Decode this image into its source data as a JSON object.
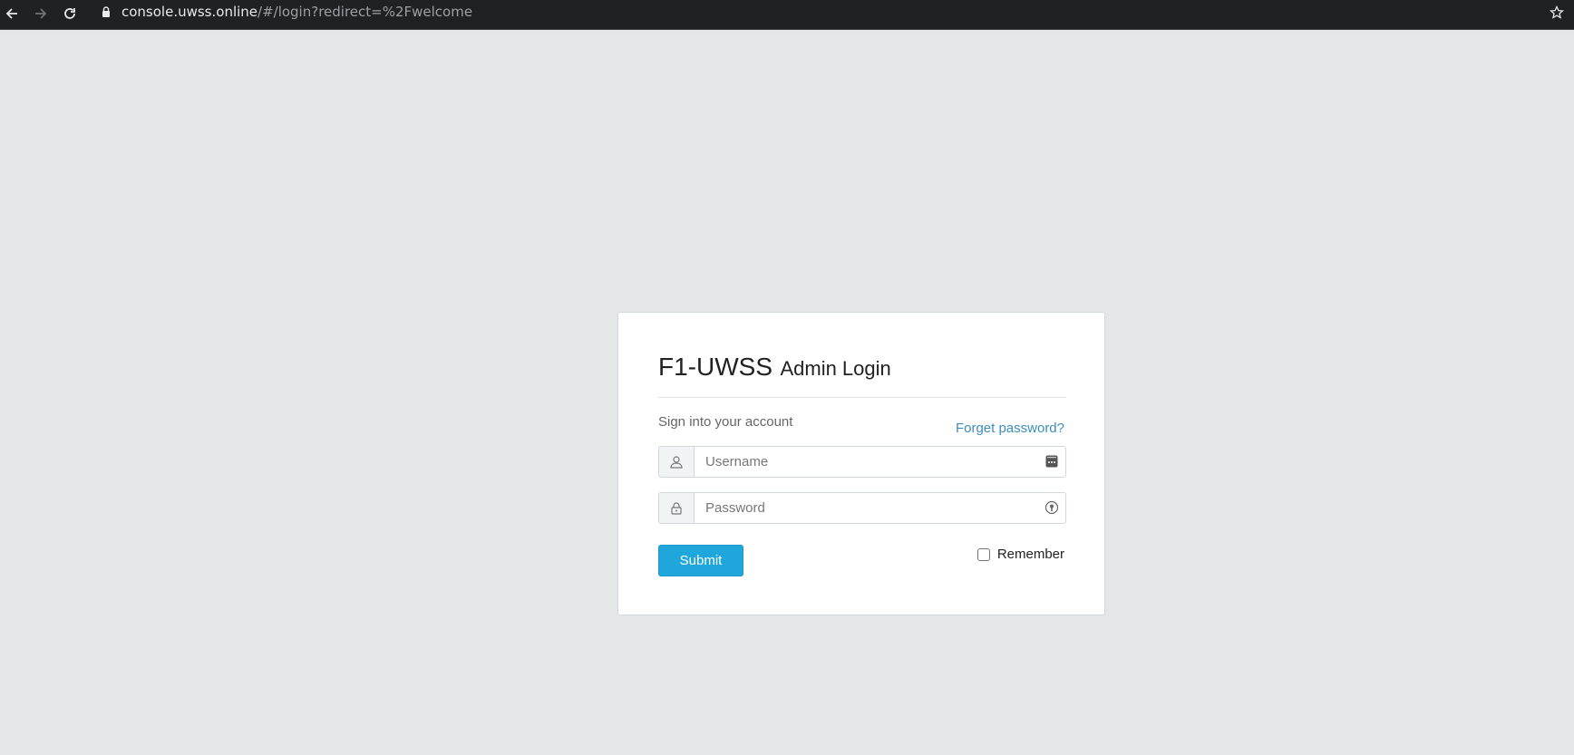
{
  "browser": {
    "url_host": "console.uwss.online",
    "url_path": "/#/login?redirect=%2Fwelcome",
    "icons": [
      "back-arrow-icon",
      "forward-arrow-icon",
      "reload-icon",
      "lock-icon",
      "bookmark-star-icon"
    ]
  },
  "login": {
    "brand": "F1-UWSS",
    "title": "Admin Login",
    "signin_text": "Sign into your account",
    "forgot_label": "Forget password?",
    "username_placeholder": "Username",
    "username_value": "",
    "password_placeholder": "Password",
    "password_value": "",
    "submit_label": "Submit",
    "remember_label": "Remember",
    "remember_checked": false
  },
  "colors": {
    "page_bg": "#e5e6e8",
    "accent": "#1fa7db",
    "link": "#3c8dbc",
    "browser_bar": "#202124"
  }
}
